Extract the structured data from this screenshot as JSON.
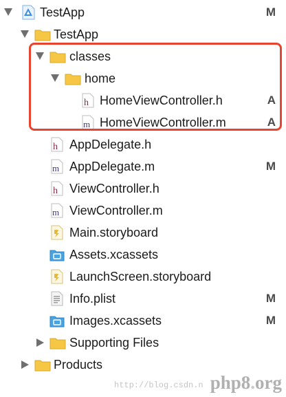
{
  "tree": {
    "project": {
      "name": "TestApp",
      "status": "M"
    },
    "group_app": {
      "name": "TestApp"
    },
    "classes": {
      "name": "classes"
    },
    "home": {
      "name": "home"
    },
    "home_vc_h": {
      "name": "HomeViewController.h",
      "status": "A"
    },
    "home_vc_m": {
      "name": "HomeViewController.m",
      "status": "A"
    },
    "appdel_h": {
      "name": "AppDelegate.h"
    },
    "appdel_m": {
      "name": "AppDelegate.m",
      "status": "M"
    },
    "vc_h": {
      "name": "ViewController.h"
    },
    "vc_m": {
      "name": "ViewController.m"
    },
    "main_sb": {
      "name": "Main.storyboard"
    },
    "assets": {
      "name": "Assets.xcassets"
    },
    "launch_sb": {
      "name": "LaunchScreen.storyboard"
    },
    "info": {
      "name": "Info.plist",
      "status": "M"
    },
    "images": {
      "name": "Images.xcassets",
      "status": "M"
    },
    "supporting": {
      "name": "Supporting Files"
    },
    "products": {
      "name": "Products"
    }
  },
  "file_letters": {
    "header": "h",
    "implementation": "m"
  },
  "watermark": {
    "url": "http://blog.csdn.n",
    "brand_main": "php8",
    "brand_dot": ".",
    "brand_tld": "org"
  },
  "colors": {
    "highlight": "#e8432e",
    "folder": "#f6c744",
    "asset_catalog": "#4aa3df",
    "project_icon": "#3b8de0"
  },
  "icons": {
    "project": "xcode-project-icon",
    "folder": "folder-icon",
    "header_file": "h-file-icon",
    "impl_file": "m-file-icon",
    "storyboard": "storyboard-icon",
    "asset_catalog": "asset-catalog-icon",
    "plist": "plist-icon"
  }
}
